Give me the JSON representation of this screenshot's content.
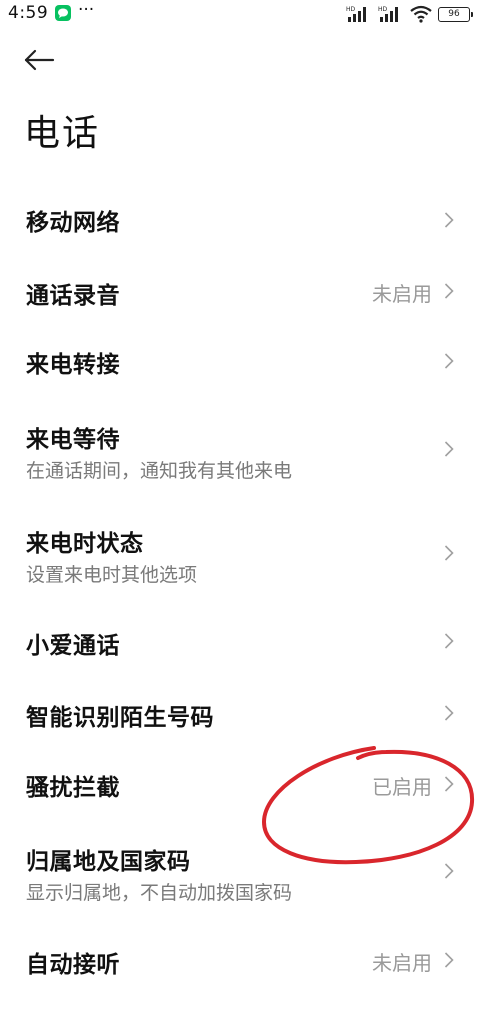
{
  "status_bar": {
    "time": "4:59",
    "dots": "···",
    "battery": "96"
  },
  "header": {
    "title": "电话"
  },
  "items": [
    {
      "title": "移动网络",
      "subtitle": "",
      "value": ""
    },
    {
      "title": "通话录音",
      "subtitle": "",
      "value": "未启用"
    },
    {
      "title": "来电转接",
      "subtitle": "",
      "value": ""
    },
    {
      "title": "来电等待",
      "subtitle": "在通话期间，通知我有其他来电",
      "value": ""
    },
    {
      "title": "来电时状态",
      "subtitle": "设置来电时其他选项",
      "value": ""
    },
    {
      "title": "小爱通话",
      "subtitle": "",
      "value": ""
    },
    {
      "title": "智能识别陌生号码",
      "subtitle": "",
      "value": ""
    },
    {
      "title": "骚扰拦截",
      "subtitle": "",
      "value": "已启用"
    },
    {
      "title": "归属地及国家码",
      "subtitle": "显示归属地，不自动加拨国家码",
      "value": ""
    },
    {
      "title": "自动接听",
      "subtitle": "",
      "value": "未启用"
    }
  ],
  "colors": {
    "annotation": "#d9262c",
    "chat_app": "#07c160"
  }
}
